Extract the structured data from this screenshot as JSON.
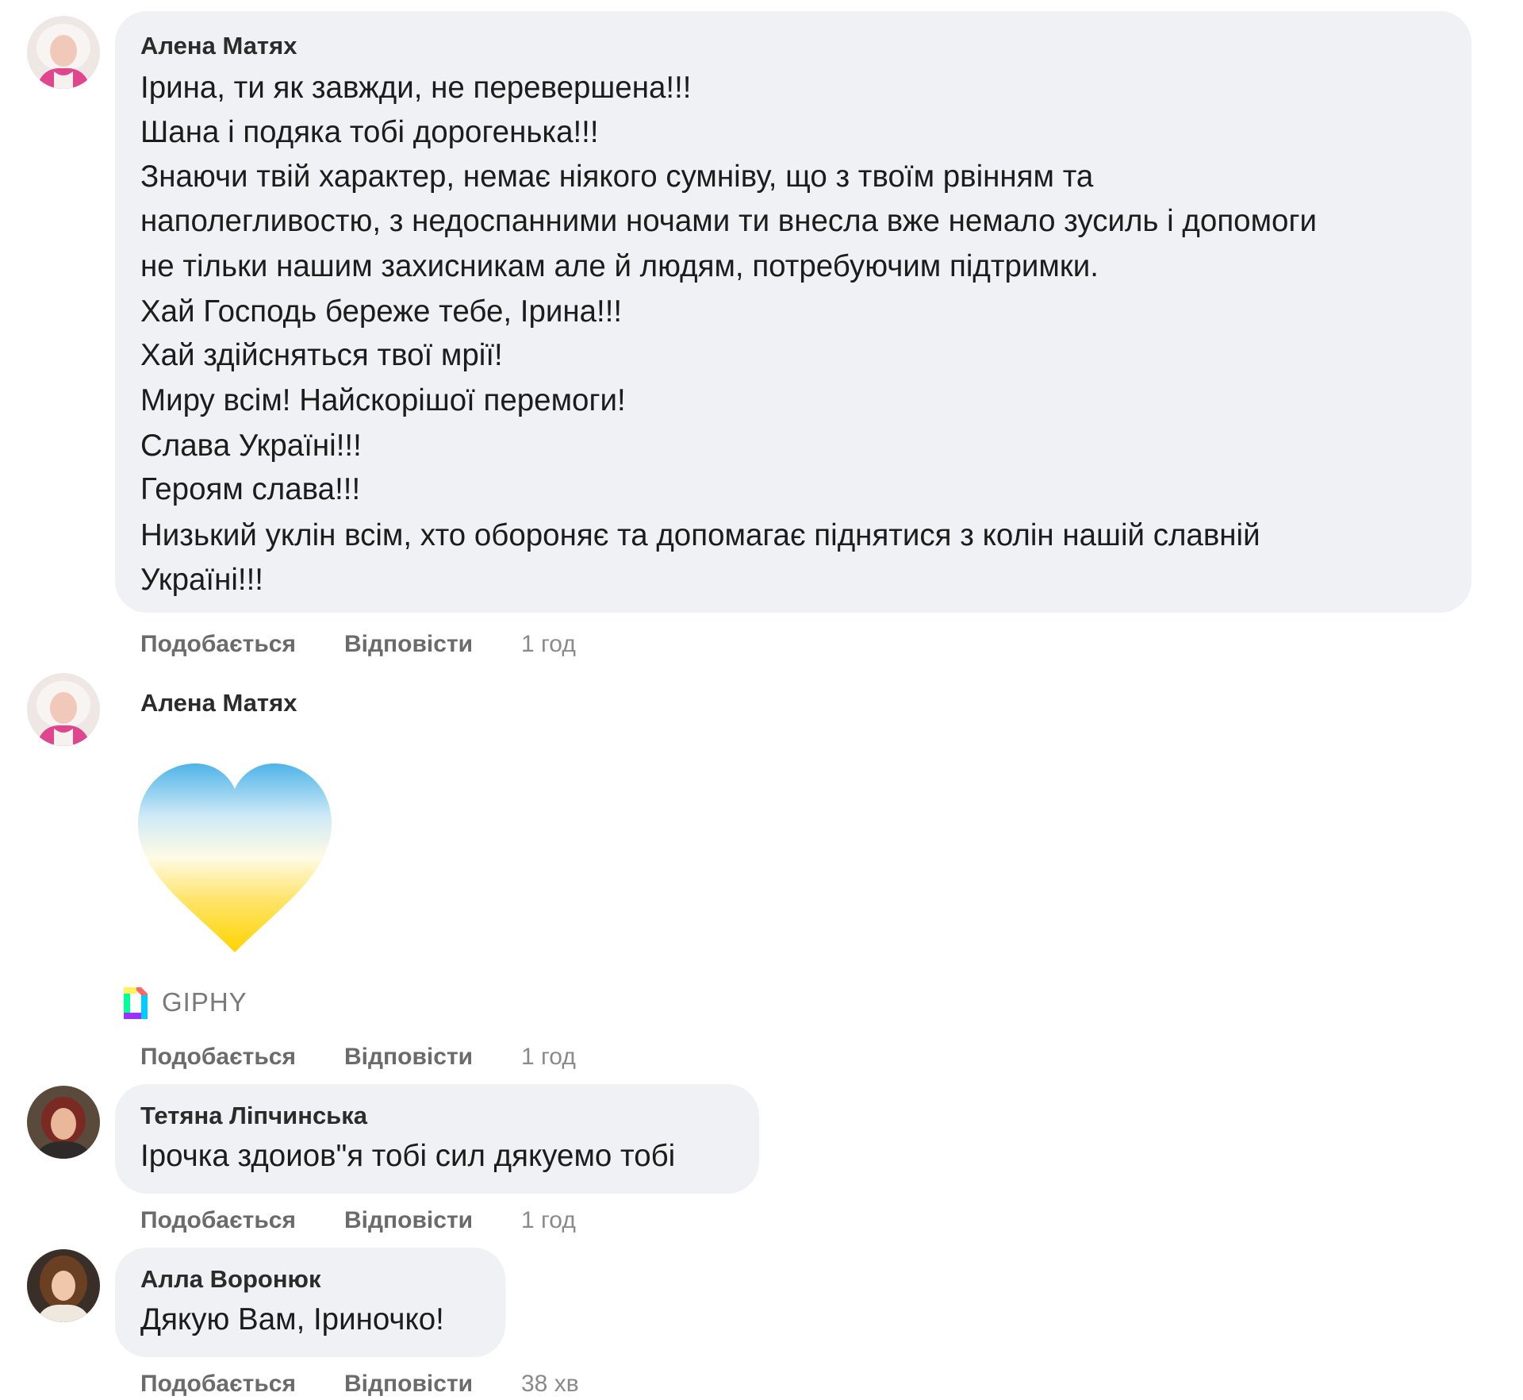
{
  "actions": {
    "like": "Подобається",
    "reply": "Відповісти"
  },
  "comments": [
    {
      "author": "Алена Матях",
      "lines": [
        "Ірина, ти як завжди, не перевершена!!!",
        "Шана і подяка тобі дорогенька!!!",
        "Знаючи твій характер, немає ніякого сумніву, що з твоїм рвінням та",
        "наполегливостю, з недоспанними ночами ти внесла вже немало зусиль і допомоги",
        "не тільки нашим захисникам але й людям, потребуючим підтримки.",
        "Хай Господь береже тебе, Ірина!!!",
        "Хай здійсняться твої мрії!",
        "Миру всім! Найскорішої перемоги!",
        "Слава Україні!!!",
        "Героям слава!!!",
        "Низький уклін всім, хто обороняє та допомагає піднятися з колін нашій славній",
        "Україні!!!"
      ],
      "time": "1 год"
    },
    {
      "author": "Алена Матях",
      "gif": {
        "icon": "ukrainian-flag-heart-icon",
        "colors": [
          "#4fb3e8",
          "#ffd400"
        ],
        "source_label": "GIPHY"
      },
      "time": "1 год"
    },
    {
      "author": "Тетяна Ліпчинська",
      "lines": [
        "Ірочка здоиов\"я тобі сил дякуемо тобі"
      ],
      "time": "1 год"
    },
    {
      "author": "Алла Воронюк",
      "lines": [
        "Дякую Вам, Іриночко!"
      ],
      "time": "38 хв"
    }
  ]
}
